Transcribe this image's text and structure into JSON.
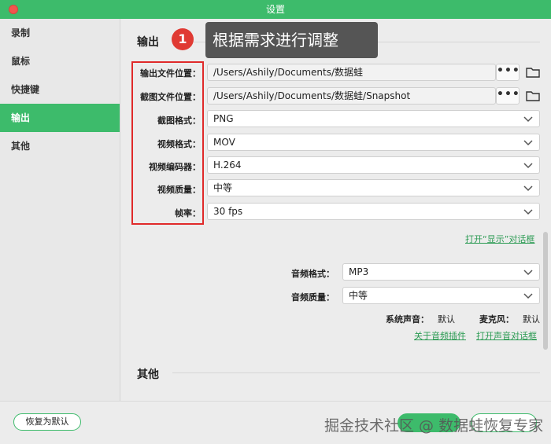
{
  "window": {
    "title": "设置"
  },
  "sidebar": {
    "items": [
      {
        "label": "录制"
      },
      {
        "label": "鼠标"
      },
      {
        "label": "快捷键"
      },
      {
        "label": "输出"
      },
      {
        "label": "其他"
      }
    ],
    "active": "输出"
  },
  "annotation": {
    "badge": "1",
    "tooltip": "根据需求进行调整"
  },
  "output": {
    "title": "输出",
    "video_path": {
      "label": "输出文件位置：",
      "value": "/Users/Ashily/Documents/数据蛙",
      "browse": "•••"
    },
    "snapshot_path": {
      "label": "截图文件位置：",
      "value": "/Users/Ashily/Documents/数据蛙/Snapshot",
      "browse": "•••"
    },
    "screenshot_format": {
      "label": "截图格式：",
      "value": "PNG"
    },
    "video_format": {
      "label": "视频格式：",
      "value": "MOV"
    },
    "video_codec": {
      "label": "视频编码器：",
      "value": "H.264"
    },
    "video_quality": {
      "label": "视频质量：",
      "value": "中等"
    },
    "frame_rate": {
      "label": "帧率：",
      "value": "30 fps"
    },
    "display_dialog_link": "打开“显示”对话框",
    "audio_format": {
      "label": "音频格式：",
      "value": "MP3"
    },
    "audio_quality": {
      "label": "音频质量：",
      "value": "中等"
    },
    "system_audio": {
      "label": "系统声音：",
      "value": "默认"
    },
    "microphone": {
      "label": "麦克风：",
      "value": "默认"
    },
    "audio_plugin_link": "关于音频插件",
    "sound_dialog_link": "打开声音对话框"
  },
  "other": {
    "title": "其他"
  },
  "footer": {
    "reset_label": "恢复为默认",
    "watermark": "掘金技术社区 @ 数据蛙恢复专家"
  },
  "colors": {
    "accent": "#3dbb6b",
    "annotation_red": "#e02a2a",
    "link": "#2a9a52"
  }
}
